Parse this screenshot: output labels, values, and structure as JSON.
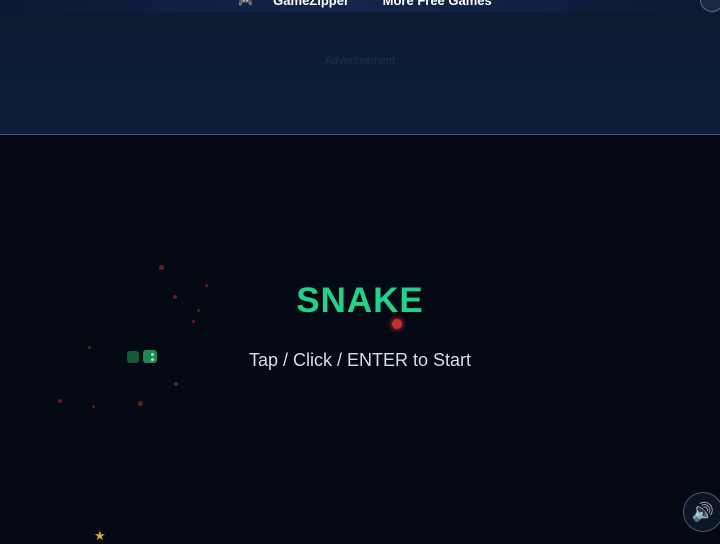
{
  "topbar": {
    "brand": "GameZipper",
    "more_games": "More Free Games"
  },
  "header": {
    "ad_text": "Advertisement"
  },
  "game": {
    "title": "SNAKE",
    "prompt": "Tap / Click / ENTER to Start"
  },
  "controls": {
    "sound_icon": "🔊"
  },
  "colors": {
    "title": "#22d28a",
    "food": "#c43030",
    "snake": "#1f8a50",
    "background": "#040914"
  }
}
